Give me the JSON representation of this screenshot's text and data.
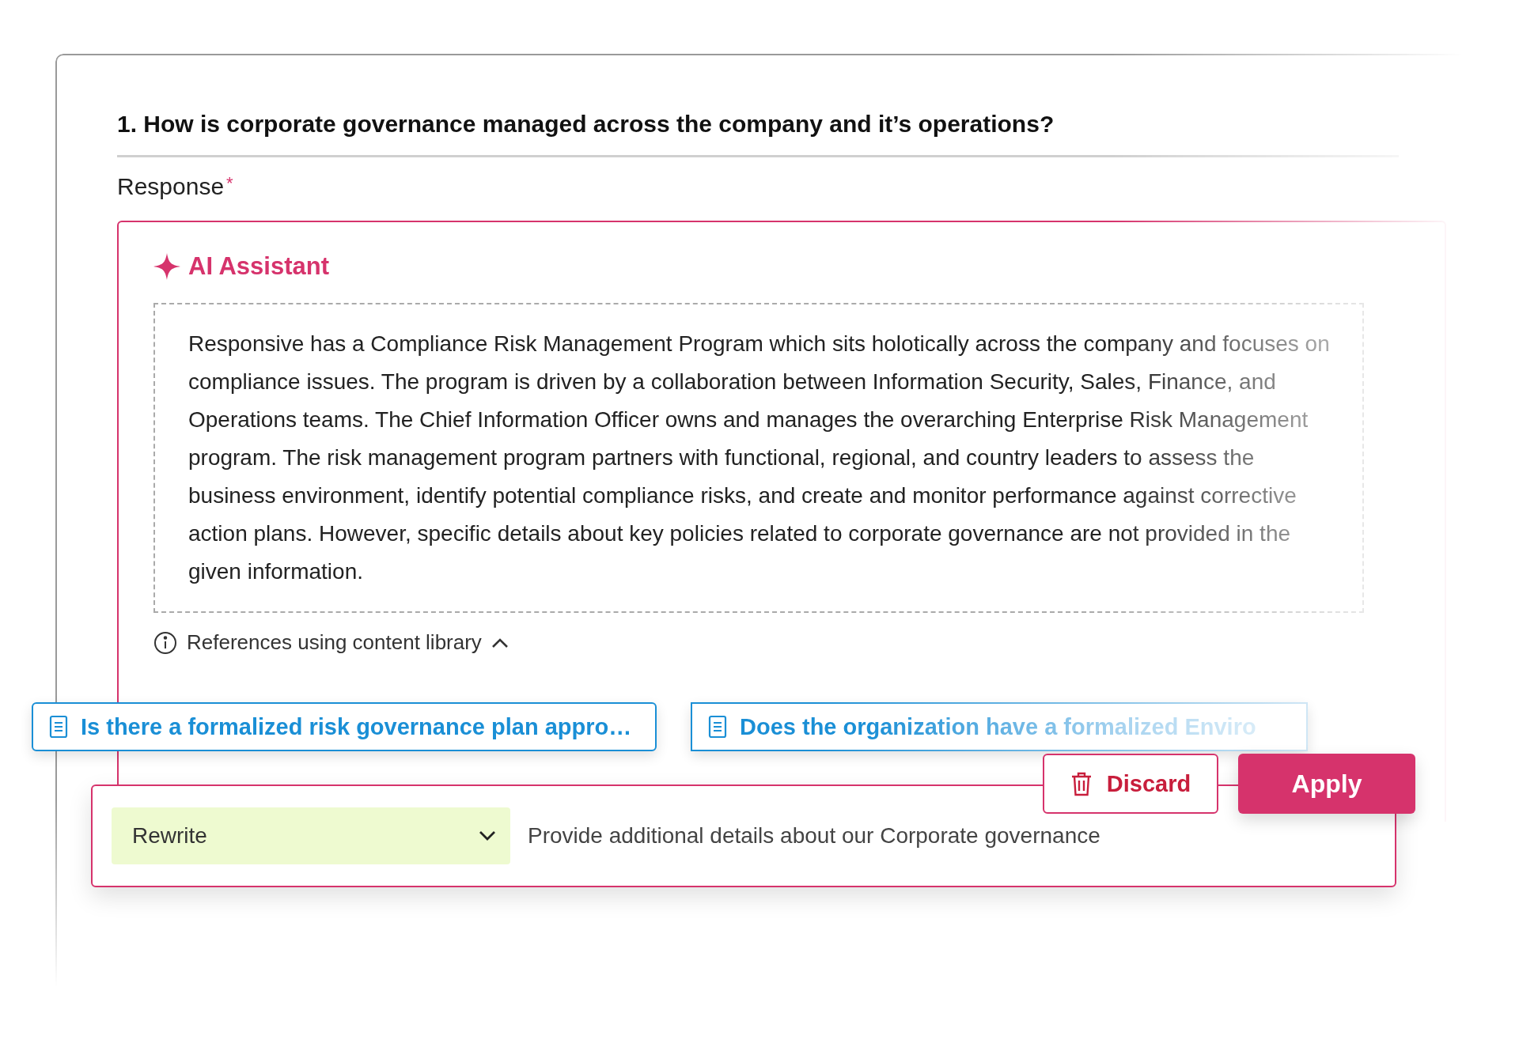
{
  "question": {
    "title": "1. How is corporate governance managed across the company and it’s operations?"
  },
  "response": {
    "label": "Response",
    "required_mark": "*"
  },
  "assistant": {
    "title": "AI Assistant",
    "answer": "Responsive has a Compliance Risk Management Program which sits holotically across the company and focuses on compliance issues. The program is driven by a collaboration between Information Security, Sales, Finance, and Operations teams. The Chief Information Officer owns and manages the overarching Enterprise Risk Management program. The risk management program partners with functional, regional, and country leaders to assess the business environment, identify potential compliance risks, and create and monitor performance against corrective action plans. However, specific details about key policies related to corporate governance are not provided in the given information.",
    "references": {
      "label": "References using content library",
      "expanded": true,
      "items": [
        {
          "title": "Is there a formalized risk governance plan appro…"
        },
        {
          "title": "Does the organization have a formalized Enviro"
        }
      ]
    }
  },
  "actions": {
    "discard": "Discard",
    "apply": "Apply"
  },
  "rewrite": {
    "mode": "Rewrite",
    "prompt": "Provide additional details about our Corporate governance"
  }
}
